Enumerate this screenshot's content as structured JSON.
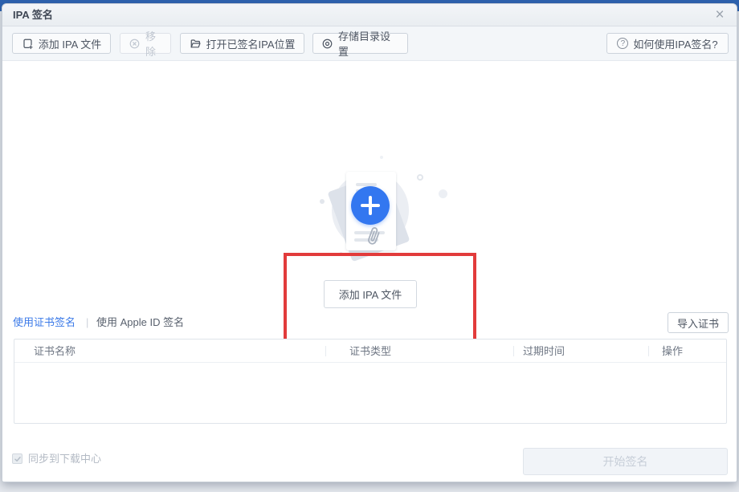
{
  "window": {
    "title": "IPA 签名",
    "close_glyph": "×"
  },
  "toolbar": {
    "buttons": [
      {
        "label": "添加 IPA 文件",
        "icon": "file-add-icon",
        "enabled": true
      },
      {
        "label": "移除",
        "icon": "remove-circle-icon",
        "enabled": false
      },
      {
        "label": "打开已签名IPA位置",
        "icon": "folder-open-icon",
        "enabled": true
      },
      {
        "label": "存储目录设置",
        "icon": "storage-target-icon",
        "enabled": true
      }
    ],
    "help": {
      "label": "如何使用IPA签名?",
      "icon": "question-circle-icon",
      "glyph": "?"
    }
  },
  "dropzone": {
    "add_button_label": "添加 IPA 文件",
    "illustration": "document-with-plus-and-paperclip"
  },
  "tabs": {
    "cert_label": "使用证书签名",
    "apple_id_label": "使用 Apple ID 签名",
    "divider_glyph": "|",
    "active": "使用证书签名"
  },
  "import_button_label": "导入证书",
  "table": {
    "headers": [
      "证书名称",
      "证书类型",
      "过期时间",
      "操作"
    ],
    "rows": []
  },
  "footer": {
    "sync_checkbox": {
      "label": "同步到下载中心",
      "checked": true,
      "enabled": false
    },
    "start_button_label": "开始签名",
    "start_button_enabled": false
  },
  "colors": {
    "accent_blue": "#3377f0",
    "tab_active_blue": "#3b7ae8",
    "annotation_red": "#e23b3b",
    "window_frame_blue": "#2e63b0",
    "disabled_text": "#c0c7d1"
  }
}
